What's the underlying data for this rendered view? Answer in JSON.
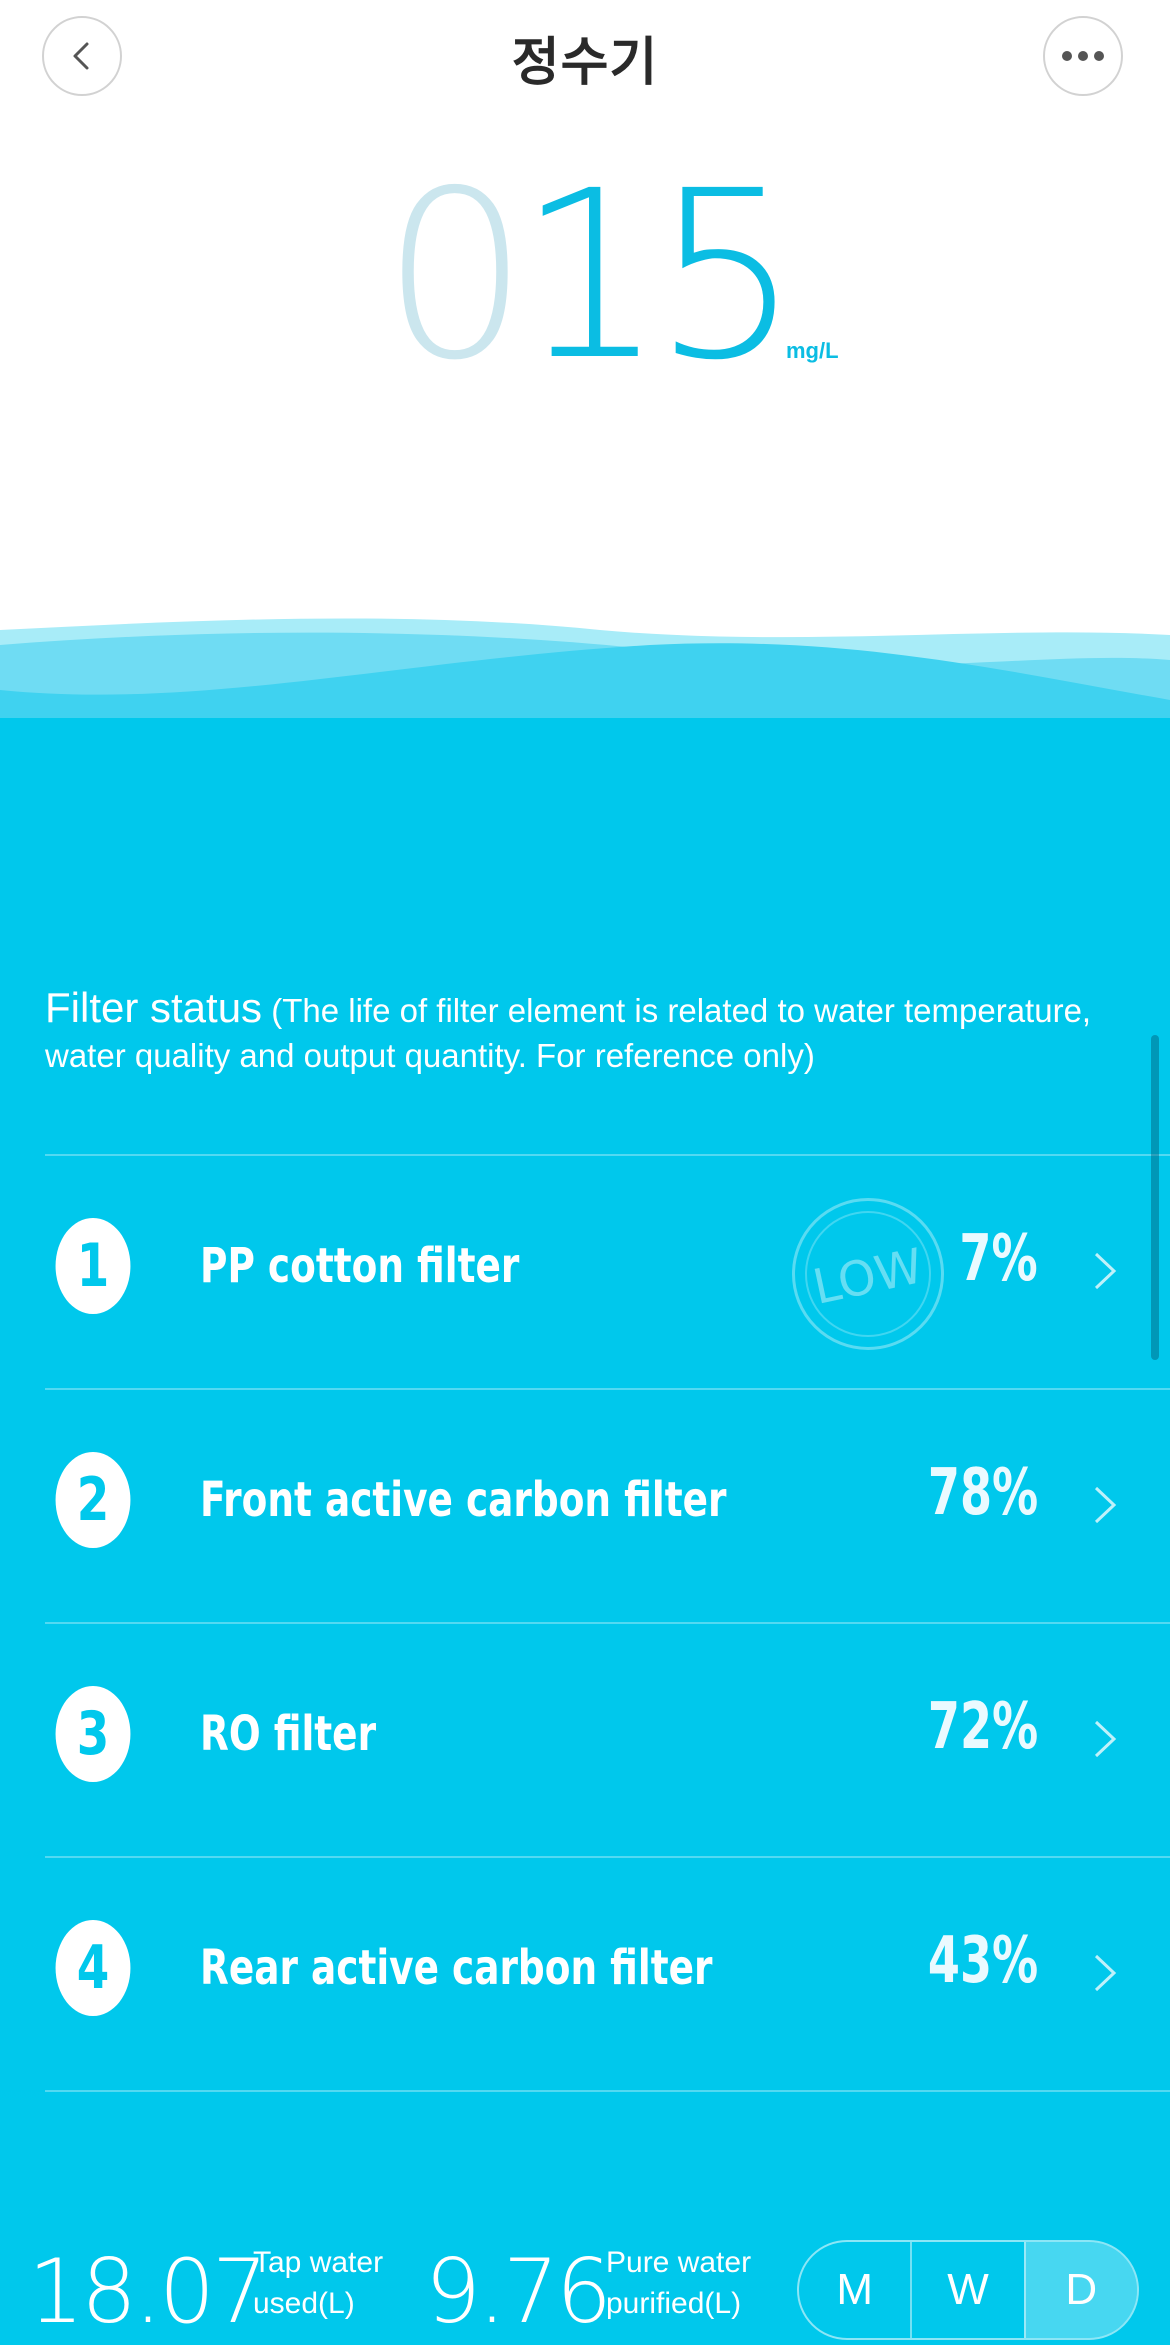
{
  "header": {
    "title": "정수기",
    "back_icon": "chevron-left-icon",
    "more_icon": "ellipsis-icon"
  },
  "tds": {
    "digit1": "0",
    "digit2": "1",
    "digit3": "5",
    "unit": "mg/L"
  },
  "filter_status": {
    "title": "Filter status",
    "note": "(The life of filter element is related to water temperature, water quality and output quantity. For reference only)",
    "low_badge": "LOW",
    "items": [
      {
        "number": "1",
        "name": "PP cotton filter",
        "percent": "7%"
      },
      {
        "number": "2",
        "name": "Front active carbon filter",
        "percent": "78%"
      },
      {
        "number": "3",
        "name": "RO filter",
        "percent": "72%"
      },
      {
        "number": "4",
        "name": "Rear active carbon filter",
        "percent": "43%"
      }
    ]
  },
  "stats": {
    "tap_value": "18.07",
    "tap_label_1": "Tap water",
    "tap_label_2": "used(L)",
    "pure_value": "9.76",
    "pure_label_1": "Pure water",
    "pure_label_2": "purified(L)",
    "periods": [
      "M",
      "W",
      "D"
    ],
    "selected_period": "D"
  },
  "colors": {
    "accent": "#00c8ec",
    "digit_dim": "#cbe6ee",
    "digit_bright": "#0bbde3"
  }
}
